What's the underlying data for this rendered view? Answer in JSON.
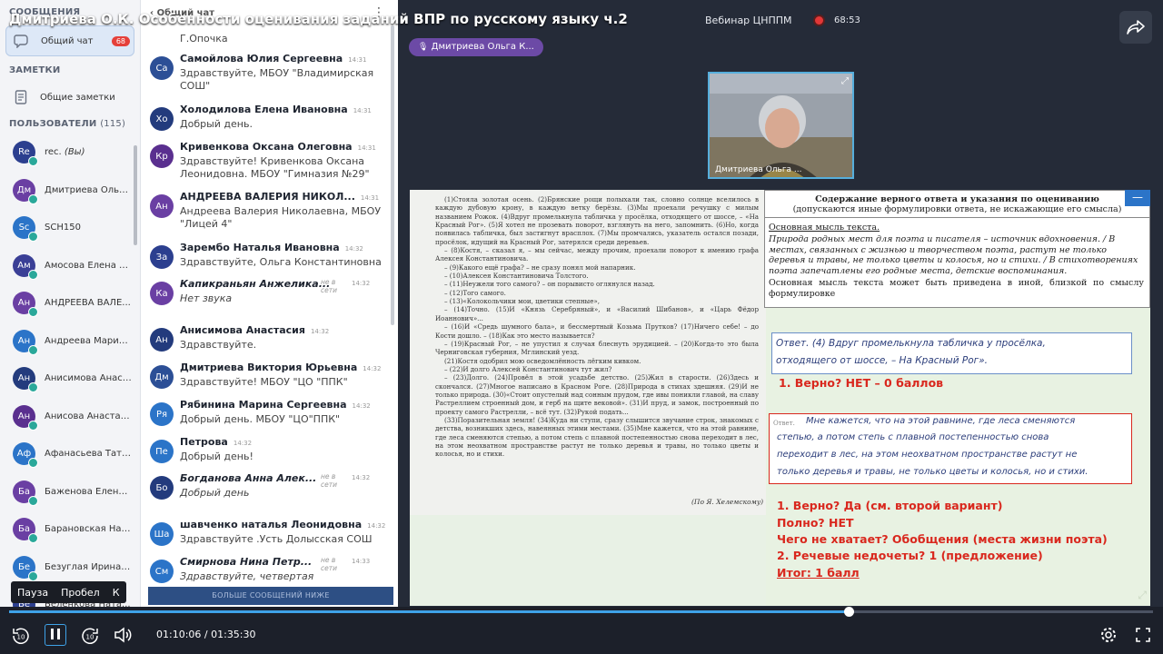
{
  "title": "Дмитриева О.К. Особенности оценивания заданий ВПР по русскому языку ч.2",
  "header": {
    "webinar_label": "Вебинар ЦНППМ",
    "rec_time": "68:53",
    "speaker": "Дмитриева Ольга К..."
  },
  "sidebar": {
    "messages_heading": "СООБЩЕНИЯ",
    "general_chat": "Общий чат",
    "general_chat_badge": "68",
    "notes_heading": "ЗАМЕТКИ",
    "shared_notes": "Общие заметки",
    "users_heading": "ПОЛЬЗОВАТЕЛИ",
    "users_count": "(115)",
    "users": [
      {
        "initials": "Re",
        "name": "rec.",
        "suffix": "(Вы)",
        "color": "#2c3f8f"
      },
      {
        "initials": "Дм",
        "name": "Дмитриева Ольга...",
        "suffix": "",
        "color": "#6a3fa3"
      },
      {
        "initials": "Sc",
        "name": "SCH150",
        "suffix": "",
        "color": "#2b74c8"
      },
      {
        "initials": "Ам",
        "name": "Амосова Елена Г...",
        "suffix": "",
        "color": "#3a3f96"
      },
      {
        "initials": "Ан",
        "name": "АНДРЕЕВА ВАЛЕ...",
        "suffix": "",
        "color": "#6a3fa3"
      },
      {
        "initials": "Ан",
        "name": "Андреева Марин...",
        "suffix": "",
        "color": "#2b74c8"
      },
      {
        "initials": "Ан",
        "name": "Анисимова Анаст...",
        "suffix": "",
        "color": "#233b7d"
      },
      {
        "initials": "Ан",
        "name": "Анисова Анастас...",
        "suffix": "",
        "color": "#5a2f8f"
      },
      {
        "initials": "Аф",
        "name": "Афанасьева Тать...",
        "suffix": "",
        "color": "#2b74c8"
      },
      {
        "initials": "Ба",
        "name": "Баженова Елена ...",
        "suffix": "",
        "color": "#6a3fa3"
      },
      {
        "initials": "Ба",
        "name": "Барановская Нат...",
        "suffix": "",
        "color": "#6a3fa3"
      },
      {
        "initials": "Бе",
        "name": "Безуглая Ирина В...",
        "suffix": "",
        "color": "#2b74c8"
      },
      {
        "initials": "Бе",
        "name": "Беленкова Ната...",
        "suffix": "",
        "color": "#2c3f8f"
      }
    ]
  },
  "chat": {
    "title": "Общий чат",
    "top_fragment": "Г.Опочка",
    "not_online": "не в сети",
    "more_button": "БОЛЬШЕ СООБЩЕНИЙ НИЖЕ",
    "messages": [
      {
        "initials": "Са",
        "color": "#2c4f96",
        "name": "Самойлова Юлия Сергеевна",
        "time": "14:31",
        "text": "Здравствуйте, МБОУ \"Владимирская СОШ\"",
        "italic": false,
        "offline": false
      },
      {
        "initials": "Хо",
        "color": "#233b7d",
        "name": "Холодилова Елена Ивановна",
        "time": "14:31",
        "text": "Добрый день.",
        "italic": false,
        "offline": false
      },
      {
        "initials": "Кр",
        "color": "#5a2f8f",
        "name": "Кривенкова Оксана Олеговна",
        "time": "14:31",
        "text": "Здравствуйте! Кривенкова Оксана Леонидовна. МБОУ \"Гимназия №29\"",
        "italic": false,
        "offline": false
      },
      {
        "initials": "Ан",
        "color": "#6a3fa3",
        "name": "АНДРЕЕВА ВАЛЕРИЯ НИКОЛ...",
        "time": "14:31",
        "text": "Андреева Валерия Николаевна, МБОУ \"Лицей 4\"",
        "italic": false,
        "offline": false
      },
      {
        "initials": "За",
        "color": "#2c3f8f",
        "name": "Зарембо Наталья Ивановна",
        "time": "14:32",
        "text": "Здравствуйте, Ольга Константиновна",
        "italic": false,
        "offline": false
      },
      {
        "initials": "Ка",
        "color": "#6a3fa3",
        "name": "Капикраньян Анжелика...",
        "time": "14:32",
        "text": "Нет звука",
        "italic": true,
        "offline": true
      },
      {
        "initials": "Ан",
        "color": "#233b7d",
        "name": "Анисимова Анастасия",
        "time": "14:32",
        "text": "Здравствуйте.",
        "italic": false,
        "offline": false
      },
      {
        "initials": "Дм",
        "color": "#2c4f96",
        "name": "Дмитриева Виктория Юрьевна",
        "time": "14:32",
        "text": "Здравствуйте! МБОУ \"ЦО \"ППК\"",
        "italic": false,
        "offline": false
      },
      {
        "initials": "Ря",
        "color": "#2b74c8",
        "name": "Рябинина Марина Сергеевна",
        "time": "14:32",
        "text": "Добрый день. МБОУ \"ЦО\"ППК\"",
        "italic": false,
        "offline": false
      },
      {
        "initials": "Пе",
        "color": "#2b74c8",
        "name": "Петрова",
        "time": "14:32",
        "text": "Добрый день!",
        "italic": false,
        "offline": false
      },
      {
        "initials": "Бо",
        "color": "#233b7d",
        "name": "Богданова Анна Алек...",
        "time": "14:32",
        "text": "Добрый день",
        "italic": true,
        "offline": true
      },
      {
        "initials": "Ша",
        "color": "#2b74c8",
        "name": "шавченко наталья Леонидовна",
        "time": "14:32",
        "text": "Здравствуйте .Усть Долысская СОШ",
        "italic": false,
        "offline": false
      },
      {
        "initials": "См",
        "color": "#2b74c8",
        "name": "Смирнова Нина Петр...",
        "time": "14:33",
        "text": "Здравствуйте, четвертая",
        "italic": true,
        "offline": true
      }
    ]
  },
  "camera": {
    "name": "Дмитриева Ольга ..."
  },
  "slide": {
    "text_paragraphs": [
      "(1)Стояла золотая осень. (2)Брянские рощи полыхали так, словно солнце вселилось в каждую дубовую крону, в каждую ветку берёзы. (3)Мы проехали речушку с милым названием Рожок. (4)Вдруг промелькнула табличка у просёлка, отходящего от шоссе, – «На Красный Рог». (5)Я хотел не прозевать поворот, взглянуть на него, запомнить. (6)Но, когда появилась табличка, был застигнут врасплох. (7)Мы промчались, указатель остался позади, просёлок, идущий на Красный Рог, затерялся среди деревьев.",
      "– (8)Костя, – сказал я, – мы сейчас, между прочим, проехали поворот к имению графа Алексея Константиновича.",
      "– (9)Какого ещё графа? – не сразу понял мой напарник.",
      "– (10)Алексея Константиновича Толстого.",
      "– (11)Неужели того самого? – он порывисто оглянулся назад.",
      "– (12)Того самого.",
      "– (13)«Колокольчики мои, цветики степные»,",
      "– (14)Точно. (15)И «Князь Серебряный», и «Василий Шибанов», и «Царь Фёдор Иоаннович»...",
      "– (16)И «Средь шумного бала», и бессмертный Козьма Прутков? (17)Ничего себе! – до Кости дошло. – (18)Как это место называется?",
      "– (19)Красный Рог, – не упустил я случая блеснуть эрудицией. – (20)Когда-то это была Черниговская губерния, Мглинский уезд.",
      "(21)Костя одобрил мою осведомлённость лёгким кивком.",
      "– (22)И долго Алексей Константинович тут жил?",
      "– (23)Долго. (24)Провёл в этой усадьбе детство. (25)Жил в старости. (26)Здесь и скончался. (27)Многое написано в Красном Роге. (28)Природа в стихах здешняя. (29)И не только природа. (30)«Стоит опустелый над сонным прудом, где ивы поникли главой, на славу Растреллием строенный дом, и герб на щите вековой». (31)И пруд, и замок, построенный по проекту самого Растрелли, – всё тут. (32)Рукой подать...",
      "(33)Поразительная земля! (34)Куда ни ступи, сразу слышится звучание строк, знакомых с детства, возникших здесь, навеянных этими местами. (35)Мне кажется, что на этой равнине, где леса сменяются степью, а потом степь с плавной постепенностью снова переходит в лес, на этом неохватном пространстве растут не только деревья и травы, но только цветы и колосья, но и стихи."
    ],
    "author": "(По Я. Хелемскому)",
    "answer_box": {
      "title": "Содержание верного ответа и указания по оцениванию",
      "subtitle": "(допускаются иные формулировки ответа, не искажающие его смысла)",
      "main_thought": "Основная мысль текста.",
      "body": "Природа родных мест для поэта и писателя – источник вдохновения. / В местах, связанных с жизнью и творчеством поэта, растут не только деревья и травы, не только цветы и колосья, но и стихи. / В стихотворениях поэта запечатлены его родные места, детские воспоминания.",
      "alternative": "Основная мысль текста может быть приведена в иной, близкой по смыслу формулировке"
    },
    "answer_label": "Ответ.",
    "student1_lines": [
      "Ответ. (4) Вдруг промелькнула табличка у просёлка,",
      "отходящего от шоссе, – На Красный Рог»."
    ],
    "verdict1": "1. Верно? НЕТ – 0 баллов",
    "student2_lines": [
      "Мне кажется, что на этой равнине, где леса сменяются",
      "степью, а потом степь с плавной постепенностью снова",
      "переходит в лес, на этом неохватном пространстве растут не",
      "только деревья и травы, не только цветы и колосья, но и стихи."
    ],
    "evaluation": [
      "1.   Верно? Да (см. второй вариант)",
      "Полно? НЕТ",
      "Чего не хватает? Обобщения (места жизни поэта)",
      "2. Речевые недочеты? 1 (предложение)",
      "Итог: 1 балл"
    ]
  },
  "player": {
    "hotkeys": [
      "Пауза",
      "Пробел",
      "К"
    ],
    "current_time": "01:10:06",
    "total_time": "01:35:30",
    "progress": 0.734,
    "skip_back_label": "10",
    "skip_forward_label": "10"
  },
  "colors": {
    "accent": "#3ea2e8",
    "rec": "#e23737",
    "red_text": "#d9281e",
    "pill": "#6c4aa6"
  }
}
